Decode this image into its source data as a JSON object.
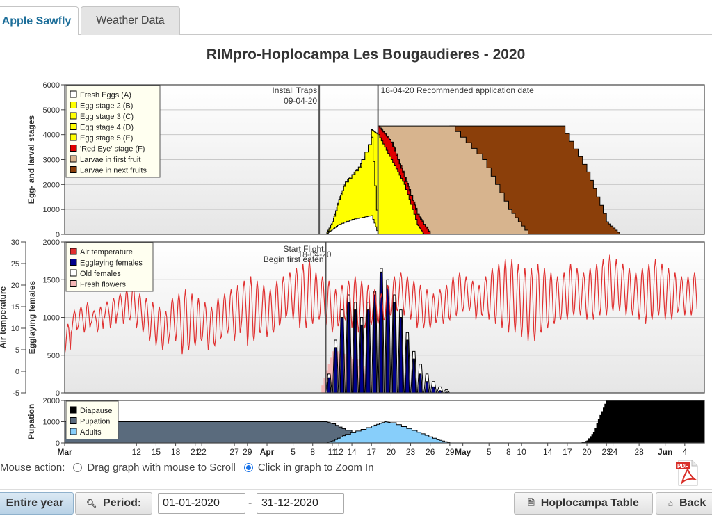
{
  "tabs": [
    {
      "label": "Apple Sawfly",
      "active": true
    },
    {
      "label": "Weather Data",
      "active": false
    }
  ],
  "chart_data": [
    {
      "type": "area",
      "title": "RIMpro-Hoplocampa  Les Bougaudieres - 2020",
      "ylabel": "Egg- and larval stages",
      "ylim": [
        0,
        6000
      ],
      "yticks": [
        0,
        1000,
        2000,
        3000,
        4000,
        5000,
        6000
      ],
      "annotations": [
        {
          "text": "Install Traps",
          "text2": "09-04-20",
          "date": "2020-04-09"
        },
        {
          "text": "18-04-20 Recommended application date",
          "date": "2020-04-18"
        }
      ],
      "legend_position": "top-left",
      "series": [
        {
          "name": "Fresh Eggs (A)",
          "color": "#ffffff",
          "points": [
            [
              "2020-04-10",
              0
            ],
            [
              "2020-04-11",
              200
            ],
            [
              "2020-04-12",
              400
            ],
            [
              "2020-04-14",
              600
            ],
            [
              "2020-04-16",
              700
            ],
            [
              "2020-04-17",
              750
            ],
            [
              "2020-04-18",
              0
            ]
          ]
        },
        {
          "name": "Egg stage 2 (B)",
          "color": "#ffff00",
          "points": [
            [
              "2020-04-10",
              0
            ],
            [
              "2020-04-11",
              500
            ],
            [
              "2020-04-12",
              1400
            ],
            [
              "2020-04-13",
              2100
            ],
            [
              "2020-04-15",
              2700
            ],
            [
              "2020-04-17",
              3500
            ],
            [
              "2020-04-18",
              3000
            ],
            [
              "2020-04-21",
              1500
            ],
            [
              "2020-04-23",
              200
            ],
            [
              "2020-04-24",
              0
            ]
          ]
        },
        {
          "name": "Egg stage 3 (C)",
          "color": "#ffff00",
          "points": []
        },
        {
          "name": "Egg stage 4 (D)",
          "color": "#ffff00",
          "points": []
        },
        {
          "name": "Egg stage 5 (E)",
          "color": "#ffff00",
          "points": [
            [
              "2020-04-17",
              4200
            ],
            [
              "2020-04-18",
              4000
            ],
            [
              "2020-04-20",
              3000
            ],
            [
              "2020-04-22",
              2000
            ],
            [
              "2020-04-24",
              400
            ],
            [
              "2020-04-25",
              0
            ]
          ]
        },
        {
          "name": "'Red Eye' stage (F)",
          "color": "#e00000",
          "points": [
            [
              "2020-04-18",
              4350
            ],
            [
              "2020-04-20",
              3700
            ],
            [
              "2020-04-22",
              2300
            ],
            [
              "2020-04-24",
              800
            ],
            [
              "2020-04-26",
              0
            ]
          ]
        },
        {
          "name": "Larvae in first fruit",
          "color": "#d7b48e",
          "points": [
            [
              "2020-04-18",
              4350
            ],
            [
              "2020-04-29",
              4350
            ],
            [
              "2020-05-04",
              3000
            ],
            [
              "2020-05-08",
              1000
            ],
            [
              "2020-05-11",
              0
            ]
          ]
        },
        {
          "name": "Larvae in next fruits",
          "color": "#8b3f0a",
          "points": [
            [
              "2020-04-29",
              4350
            ],
            [
              "2020-05-16",
              4350
            ],
            [
              "2020-05-20",
              2500
            ],
            [
              "2020-05-23",
              500
            ],
            [
              "2020-05-25",
              0
            ]
          ]
        }
      ]
    },
    {
      "type": "line",
      "ylabel": "Air temperature",
      "ylabel2": "Egglaying females",
      "ylim": [
        -5,
        30
      ],
      "ylim2": [
        0,
        2000
      ],
      "yticks": [
        -5,
        0,
        5,
        10,
        15,
        20,
        25,
        30
      ],
      "yticks2": [
        0,
        500,
        1000,
        1500,
        2000
      ],
      "annotations": [
        {
          "text": "Start Flight",
          "date": "2020-04-10"
        },
        {
          "text": "Begin first eaten",
          "date": "2020-04-10"
        },
        {
          "text": "18-04-20",
          "date": "2020-04-18"
        }
      ],
      "legend_position": "top-left",
      "series": [
        {
          "name": "Air temperature",
          "color": "#e03030",
          "axis": "left",
          "daily_min": [
            4,
            9,
            10,
            9,
            11,
            9,
            12,
            10,
            13,
            11,
            12,
            10,
            9,
            7,
            6,
            5,
            8,
            7,
            4,
            5,
            6,
            7,
            5,
            6,
            8,
            9,
            7,
            10,
            6,
            7,
            9,
            8,
            9,
            11,
            13,
            12,
            10,
            10,
            11,
            12,
            10,
            9,
            11,
            12,
            10,
            9,
            10,
            11,
            11,
            12,
            13,
            14,
            13,
            12,
            10,
            10,
            10,
            12,
            11,
            12,
            13,
            14,
            14,
            12,
            13,
            12,
            11,
            10,
            9,
            9,
            8,
            7,
            7,
            9,
            10,
            11,
            12,
            12,
            13,
            13,
            12,
            12,
            13,
            13,
            14,
            14,
            13,
            13,
            12,
            11,
            12,
            13,
            12,
            12,
            14,
            13,
            13
          ],
          "daily_max": [
            11,
            14,
            15,
            16,
            14,
            15,
            16,
            17,
            18,
            19,
            20,
            18,
            17,
            16,
            15,
            14,
            17,
            18,
            19,
            18,
            17,
            16,
            15,
            17,
            18,
            19,
            20,
            21,
            22,
            21,
            20,
            19,
            21,
            22,
            23,
            24,
            25,
            26,
            23,
            22,
            21,
            19,
            20,
            21,
            22,
            21,
            20,
            19,
            18,
            20,
            22,
            23,
            22,
            21,
            20,
            19,
            18,
            19,
            20,
            22,
            23,
            22,
            21,
            20,
            22,
            24,
            25,
            26,
            26,
            25,
            24,
            24,
            25,
            24,
            23,
            22,
            23,
            25,
            24,
            23,
            24,
            25,
            26,
            27,
            26,
            25,
            24,
            23,
            24,
            25,
            26,
            25,
            24,
            23,
            22,
            22,
            23
          ]
        },
        {
          "name": "Egglaying females",
          "color": "#00008b",
          "axis": "right",
          "daily_peak": [
            0,
            200,
            600,
            1000,
            1200,
            1100,
            900,
            1100,
            1300,
            1600,
            1400,
            1200,
            1000,
            700,
            450,
            250,
            150,
            80,
            30,
            10,
            0
          ]
        },
        {
          "name": "Old females",
          "color": "#ffffff",
          "axis": "right",
          "daily_peak": [
            0,
            250,
            700,
            1100,
            1300,
            1200,
            1000,
            1200,
            1350,
            1650,
            1500,
            1300,
            1100,
            800,
            550,
            380,
            250,
            150,
            80,
            40,
            0
          ]
        },
        {
          "name": "Fresh flowers",
          "color": "#f4b6b6",
          "axis": "right",
          "points": [
            [
              "2020-04-09",
              0
            ],
            [
              "2020-04-10",
              300
            ],
            [
              "2020-04-11",
              550
            ],
            [
              "2020-04-14",
              450
            ],
            [
              "2020-04-17",
              150
            ],
            [
              "2020-04-19",
              0
            ]
          ]
        }
      ],
      "x_start": "2020-03-01"
    },
    {
      "type": "area",
      "ylabel": "Pupation",
      "ylim": [
        0,
        2000
      ],
      "yticks": [
        0,
        1000,
        2000
      ],
      "legend_position": "top-left",
      "series": [
        {
          "name": "Diapause",
          "color": "#000000",
          "points": [
            [
              "2020-05-19",
              0
            ],
            [
              "2020-05-20",
              100
            ],
            [
              "2020-05-21",
              500
            ],
            [
              "2020-05-22",
              1300
            ],
            [
              "2020-05-23",
              2000
            ],
            [
              "2020-06-07",
              2000
            ]
          ]
        },
        {
          "name": "Pupation",
          "color": "#5a6b7d",
          "points": [
            [
              "2020-03-01",
              1000
            ],
            [
              "2020-04-10",
              1000
            ],
            [
              "2020-04-11",
              900
            ],
            [
              "2020-04-13",
              600
            ],
            [
              "2020-04-17",
              200
            ],
            [
              "2020-04-20",
              0
            ]
          ]
        },
        {
          "name": "Adults",
          "color": "#87cefa",
          "points": [
            [
              "2020-04-10",
              0
            ],
            [
              "2020-04-11",
              100
            ],
            [
              "2020-04-13",
              400
            ],
            [
              "2020-04-17",
              800
            ],
            [
              "2020-04-19",
              1000
            ],
            [
              "2020-04-20",
              950
            ],
            [
              "2020-04-24",
              500
            ],
            [
              "2020-04-27",
              150
            ],
            [
              "2020-04-29",
              0
            ]
          ]
        }
      ],
      "x_axis": {
        "ticks": [
          {
            "label": "Mar",
            "date": "2020-03-01",
            "bold": true
          },
          {
            "label": "12",
            "date": "2020-03-12"
          },
          {
            "label": "15",
            "date": "2020-03-15"
          },
          {
            "label": "18",
            "date": "2020-03-18"
          },
          {
            "label": "21",
            "date": "2020-03-21"
          },
          {
            "label": "22",
            "date": "2020-03-22"
          },
          {
            "label": "27",
            "date": "2020-03-27"
          },
          {
            "label": "29",
            "date": "2020-03-29"
          },
          {
            "label": "Apr",
            "date": "2020-04-01",
            "bold": true
          },
          {
            "label": "5",
            "date": "2020-04-05"
          },
          {
            "label": "8",
            "date": "2020-04-08"
          },
          {
            "label": "11",
            "date": "2020-04-11"
          },
          {
            "label": "12",
            "date": "2020-04-12"
          },
          {
            "label": "14",
            "date": "2020-04-14"
          },
          {
            "label": "17",
            "date": "2020-04-17"
          },
          {
            "label": "20",
            "date": "2020-04-20"
          },
          {
            "label": "23",
            "date": "2020-04-23"
          },
          {
            "label": "26",
            "date": "2020-04-26"
          },
          {
            "label": "29",
            "date": "2020-04-29"
          },
          {
            "label": "May",
            "date": "2020-05-01",
            "bold": true
          },
          {
            "label": "5",
            "date": "2020-05-05"
          },
          {
            "label": "8",
            "date": "2020-05-08"
          },
          {
            "label": "10",
            "date": "2020-05-10"
          },
          {
            "label": "14",
            "date": "2020-05-14"
          },
          {
            "label": "17",
            "date": "2020-05-17"
          },
          {
            "label": "20",
            "date": "2020-05-20"
          },
          {
            "label": "23",
            "date": "2020-05-23"
          },
          {
            "label": "24",
            "date": "2020-05-24"
          },
          {
            "label": "28",
            "date": "2020-05-28"
          },
          {
            "label": "Jun",
            "date": "2020-06-01",
            "bold": true
          },
          {
            "label": "4",
            "date": "2020-06-04"
          }
        ]
      }
    }
  ],
  "controls": {
    "mouse_action_label": "Mouse action:",
    "option_scroll": "Drag graph with mouse to Scroll",
    "option_zoom": "Click in graph to Zoom In",
    "selected": "zoom"
  },
  "bottom": {
    "entire_year": "Entire year",
    "period": "Period:",
    "from_date": "01-01-2020",
    "dash": "-",
    "to_date": "31-12-2020",
    "hoplocampa_table": "Hoplocampa Table",
    "back": "Back"
  },
  "pdf_icon_text": "PDF",
  "colors": {
    "tab_active": "#1e6f9a",
    "plot_bg": "#f0f0f0",
    "panel_border": "#444444"
  },
  "icons": {
    "period": "magnifier-icon",
    "table": "document-icon",
    "back": "home-icon",
    "pdf": "pdf-file-icon"
  }
}
